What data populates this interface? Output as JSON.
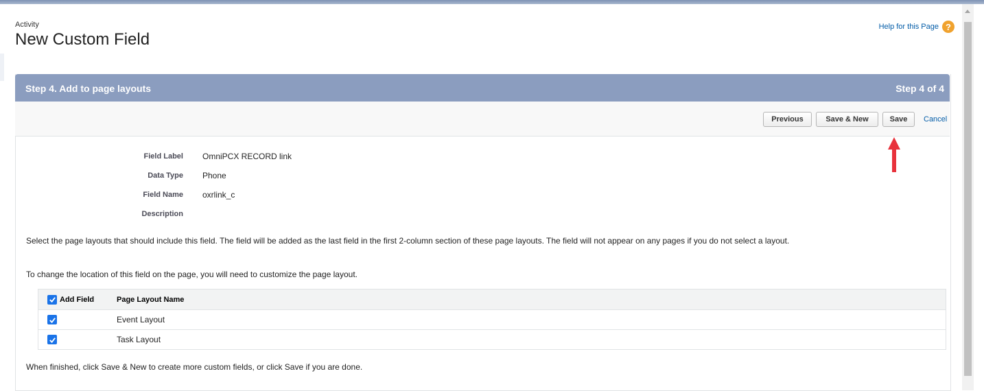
{
  "header": {
    "object_type": "Activity",
    "title": "New Custom Field",
    "help_link": "Help for this Page",
    "help_icon": "question-icon"
  },
  "step": {
    "title": "Step 4. Add to page layouts",
    "counter": "Step 4 of 4"
  },
  "buttons": {
    "previous": "Previous",
    "save_new": "Save & New",
    "save": "Save",
    "cancel": "Cancel"
  },
  "annotation": {
    "arrow_color": "#e8323c",
    "arrow_icon": "up-arrow-icon"
  },
  "details": [
    {
      "label": "Field Label",
      "value": "OmniPCX RECORD link"
    },
    {
      "label": "Data Type",
      "value": "Phone"
    },
    {
      "label": "Field Name",
      "value": "oxrlink_c"
    },
    {
      "label": "Description",
      "value": ""
    }
  ],
  "instructions": {
    "select": "Select the page layouts that should include this field. The field will be added as the last field in the first 2-column section of these page layouts. The field will not appear on any pages if you do not select a layout.",
    "location": "To change the location of this field on the page, you will need to customize the page layout.",
    "finish": "When finished, click Save & New to create more custom fields, or click Save if you are done."
  },
  "table": {
    "columns": [
      "Add Field",
      "Page Layout Name"
    ],
    "header_checked": true,
    "rows": [
      {
        "checked": true,
        "name": "Event Layout"
      },
      {
        "checked": true,
        "name": "Task Layout"
      }
    ]
  },
  "colors": {
    "step_header_bg": "#8b9dbf",
    "link": "#015ba7",
    "checkbox": "#1a73e8",
    "help_icon": "#f0a22e"
  }
}
